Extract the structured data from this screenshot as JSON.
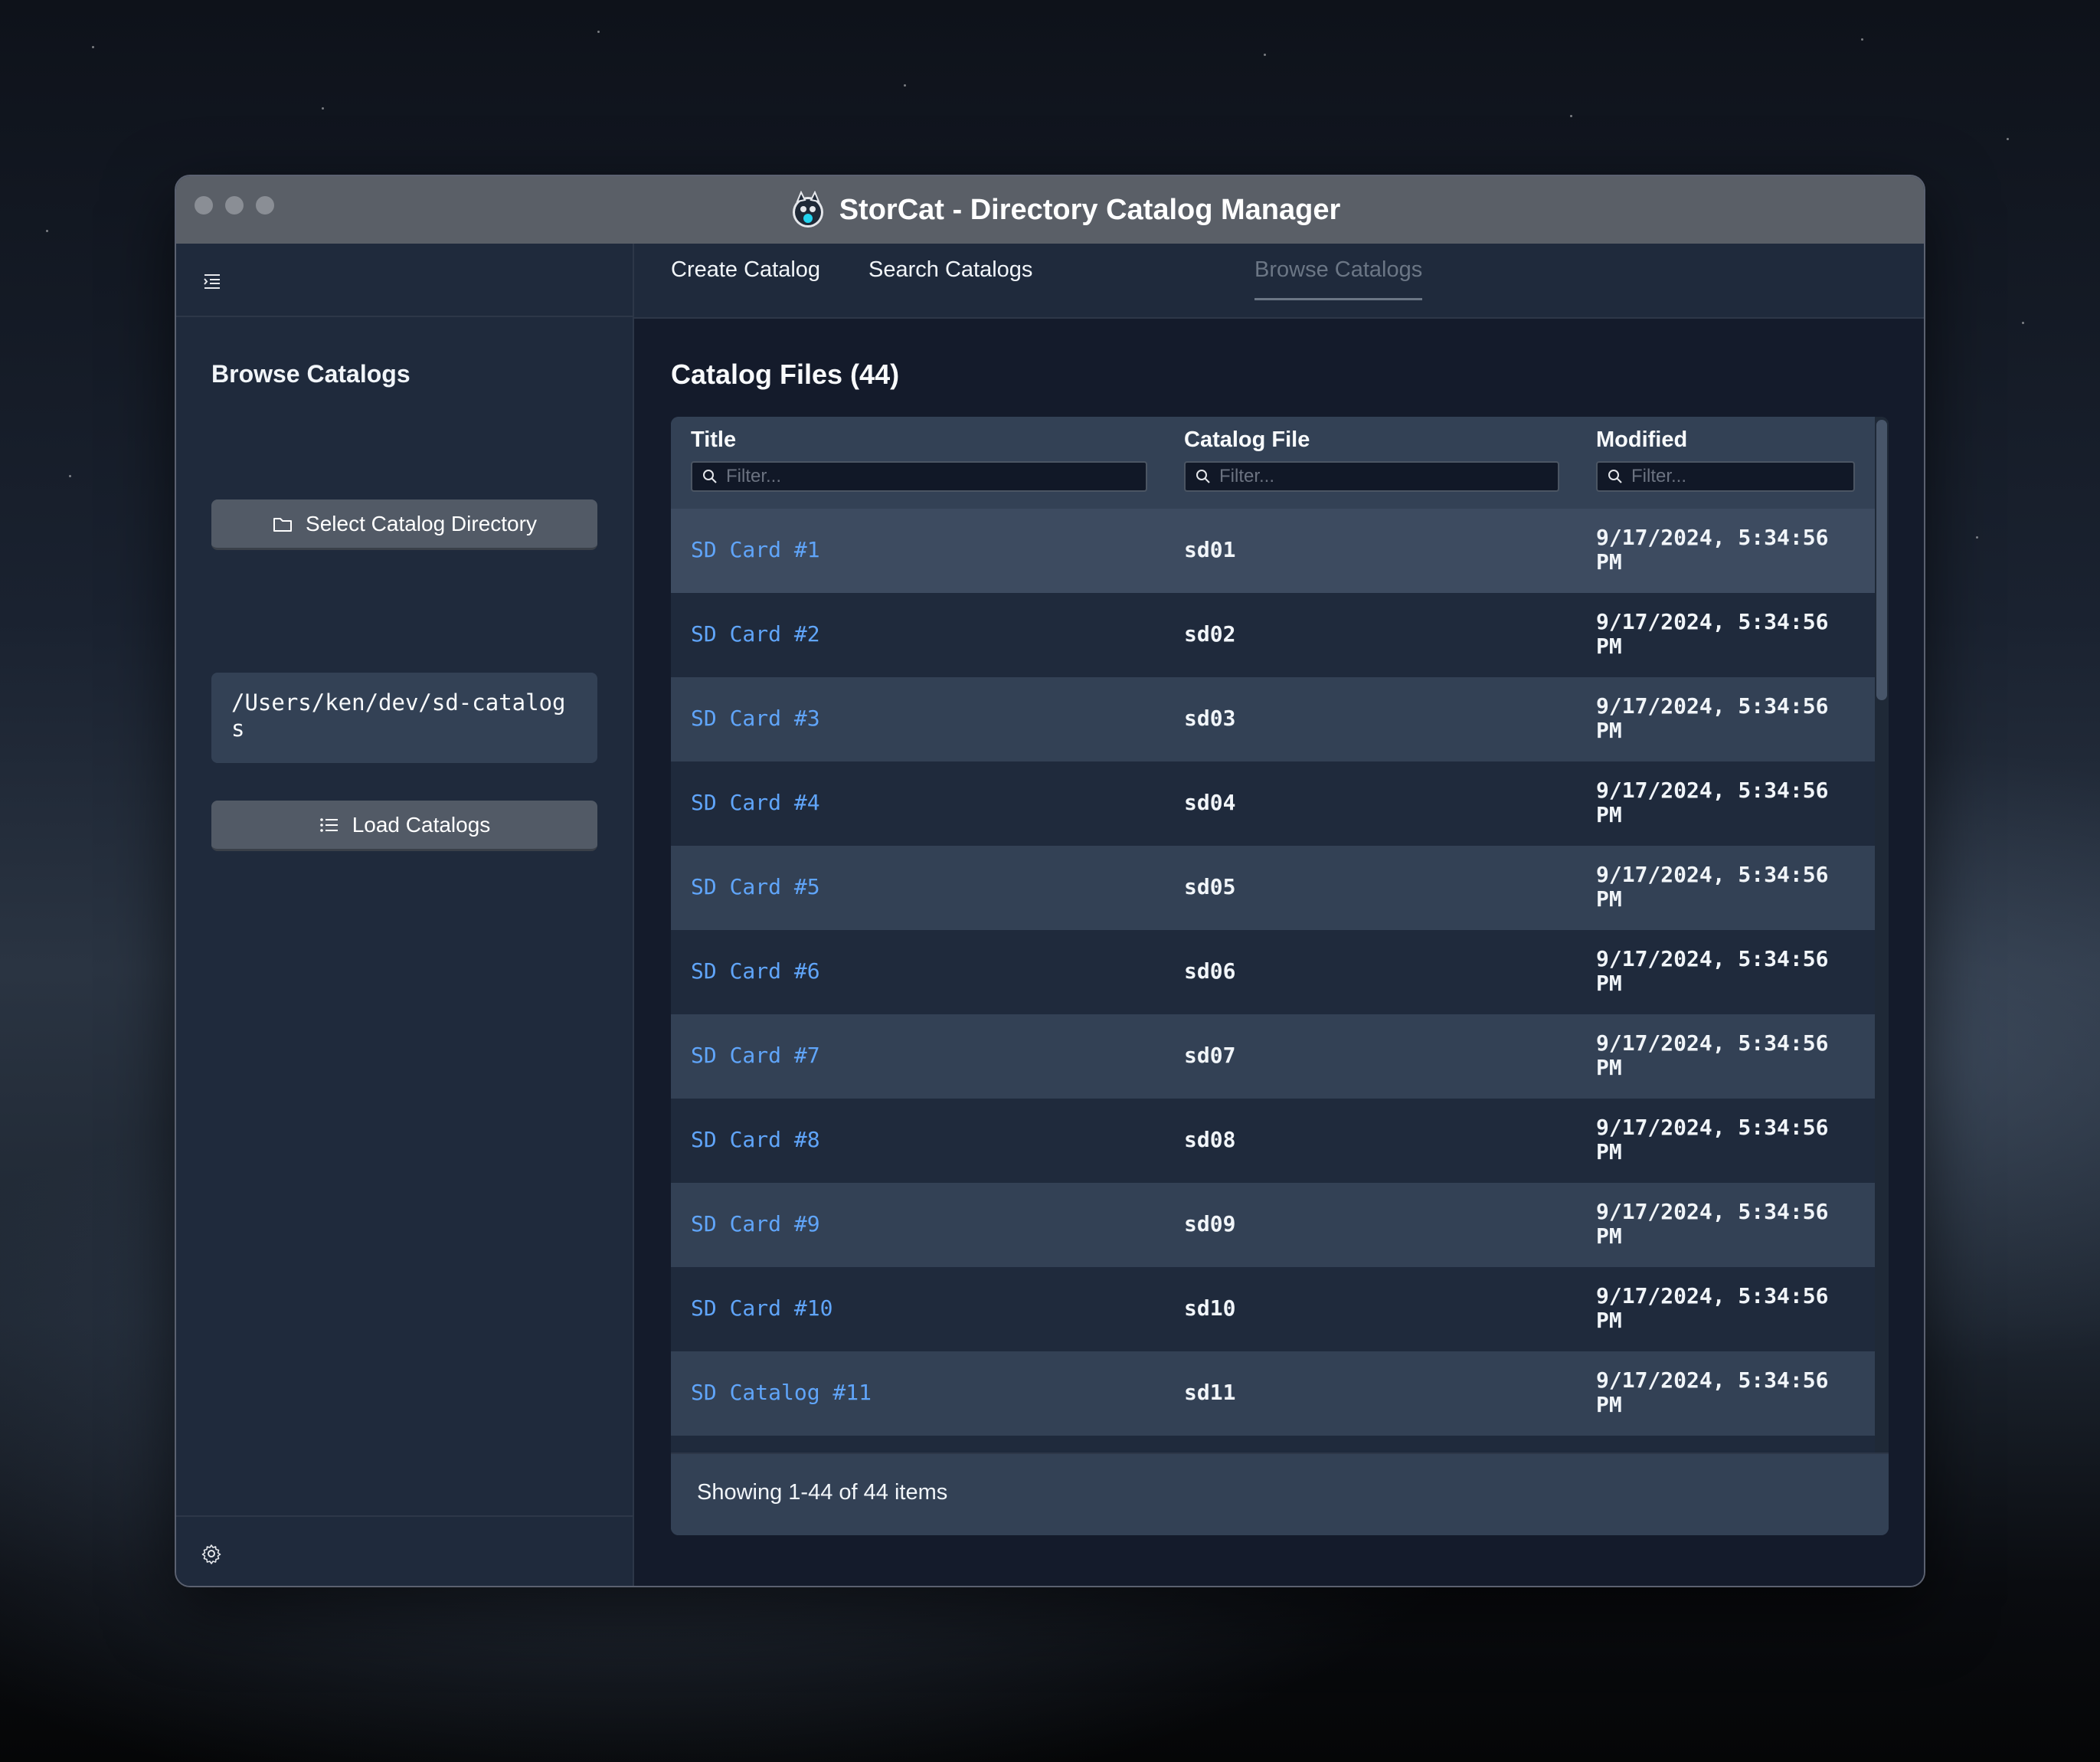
{
  "window": {
    "title": "StorCat - Directory Catalog Manager"
  },
  "sidebar": {
    "heading": "Browse Catalogs",
    "select_button_label": "Select Catalog Directory",
    "directory_path": "/Users/ken/dev/sd-catalogs",
    "load_button_label": "Load Catalogs"
  },
  "tabs": [
    {
      "label": "Create Catalog",
      "active": false
    },
    {
      "label": "Search Catalogs",
      "active": false
    },
    {
      "label": "Browse Catalogs",
      "active": true
    }
  ],
  "main": {
    "section_title": "Catalog Files (44)",
    "columns": [
      {
        "label": "Title",
        "filter_placeholder": "Filter..."
      },
      {
        "label": "Catalog File",
        "filter_placeholder": "Filter..."
      },
      {
        "label": "Modified",
        "filter_placeholder": "Filter..."
      }
    ],
    "rows": [
      {
        "title": "SD Card #1",
        "file": "sd01",
        "modified": "9/17/2024, 5:34:56 PM"
      },
      {
        "title": "SD Card #2",
        "file": "sd02",
        "modified": "9/17/2024, 5:34:56 PM"
      },
      {
        "title": "SD Card #3",
        "file": "sd03",
        "modified": "9/17/2024, 5:34:56 PM"
      },
      {
        "title": "SD Card #4",
        "file": "sd04",
        "modified": "9/17/2024, 5:34:56 PM"
      },
      {
        "title": "SD Card #5",
        "file": "sd05",
        "modified": "9/17/2024, 5:34:56 PM"
      },
      {
        "title": "SD Card #6",
        "file": "sd06",
        "modified": "9/17/2024, 5:34:56 PM"
      },
      {
        "title": "SD Card #7",
        "file": "sd07",
        "modified": "9/17/2024, 5:34:56 PM"
      },
      {
        "title": "SD Card #8",
        "file": "sd08",
        "modified": "9/17/2024, 5:34:56 PM"
      },
      {
        "title": "SD Card #9",
        "file": "sd09",
        "modified": "9/17/2024, 5:34:56 PM"
      },
      {
        "title": "SD Card #10",
        "file": "sd10",
        "modified": "9/17/2024, 5:34:56 PM"
      },
      {
        "title": "SD Catalog #11",
        "file": "sd11",
        "modified": "9/17/2024, 5:34:56 PM"
      }
    ],
    "footer_text": "Showing 1-44 of 44 items"
  },
  "icons": {
    "app": "storcat-logo-icon",
    "menu": "menu-indent-icon",
    "folder": "folder-icon",
    "list": "list-icon",
    "search": "search-icon",
    "settings": "gear-icon"
  },
  "colors": {
    "link": "#60a5fa",
    "sidebar_bg": "#1f2a3c",
    "main_bg": "#141b2b",
    "button_bg": "#525a66",
    "titlebar_bg": "#5a5f67"
  }
}
